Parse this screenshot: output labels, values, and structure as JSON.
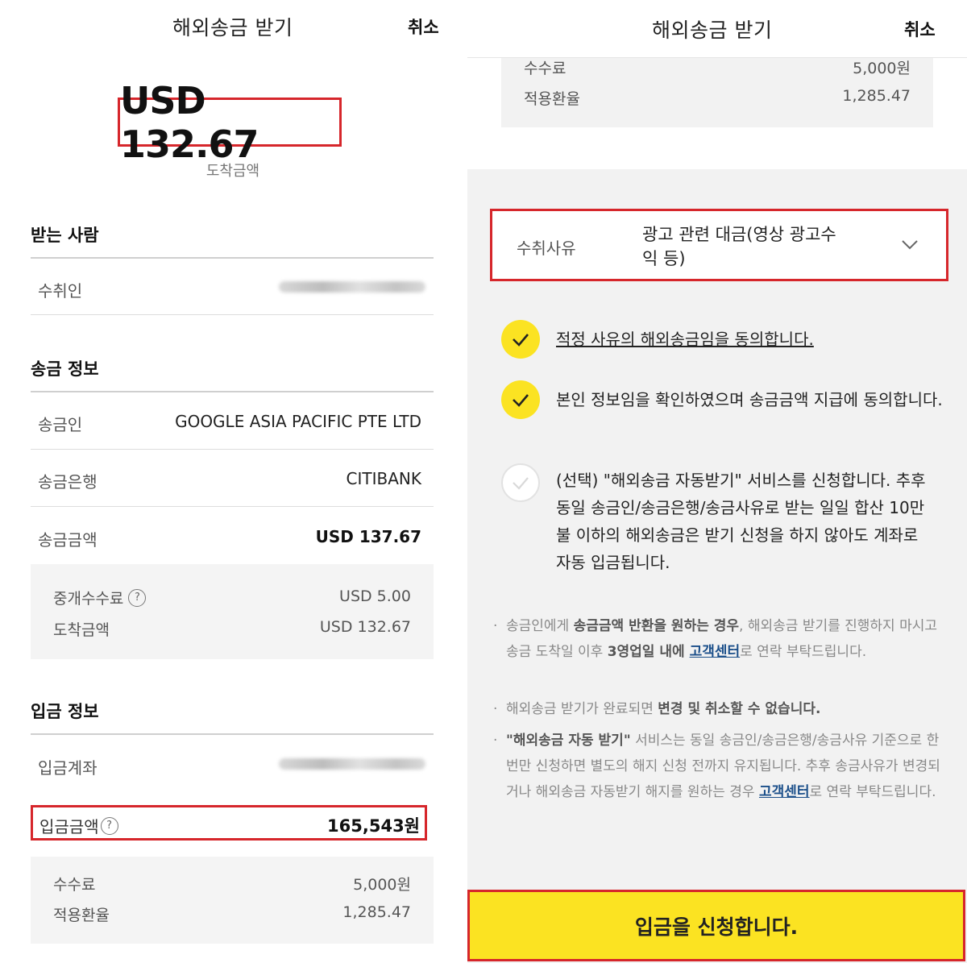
{
  "left": {
    "header": {
      "title": "해외송금 받기",
      "cancel": "취소"
    },
    "amount": "USD 132.67",
    "amount_label": "도착금액",
    "receiver_section": {
      "title": "받는 사람",
      "payee_label": "수취인"
    },
    "transfer_section": {
      "title": "송금 정보",
      "sender_label": "송금인",
      "sender_value": "GOOGLE ASIA PACIFIC PTE LTD",
      "bank_label": "송금은행",
      "bank_value": "CITIBANK",
      "amount_label": "송금금액",
      "amount_value": "USD 137.67",
      "fee_label": "중개수수료",
      "fee_value": "USD 5.00",
      "arrive_label": "도착금액",
      "arrive_value": "USD 132.67"
    },
    "deposit_section": {
      "title": "입금 정보",
      "account_label": "입금계좌",
      "amount_label": "입금금액",
      "amount_value": "165,543원",
      "fee_label": "수수료",
      "fee_value": "5,000원",
      "rate_label": "적용환율",
      "rate_value": "1,285.47"
    },
    "help_glyph": "?"
  },
  "right": {
    "header": {
      "title": "해외송금 받기",
      "cancel": "취소"
    },
    "fee_label": "수수료",
    "fee_value": "5,000원",
    "rate_label": "적용환율",
    "rate_value": "1,285.47",
    "reason_label": "수취사유",
    "reason_value": "광고 관련 대금(영상 광고수익 등)",
    "agreements": [
      {
        "text": "적정 사유의 해외송금임을 동의합니다.",
        "checked": true
      },
      {
        "text": "본인 정보임을 확인하였으며 송금금액 지급에 동의합니다.",
        "checked": true
      },
      {
        "text": "(선택) \"해외송금 자동받기\" 서비스를 신청합니다. 추후 동일 송금인/송금은행/송금사유로 받는 일일 합산 10만불 이하의 해외송금은 받기 신청을 하지 않아도 계좌로 자동 입금됩니다.",
        "checked": false
      }
    ],
    "notes": {
      "n1_a": "송금인에게 ",
      "n1_b": "송금금액 반환을 원하는 경우",
      "n1_c": ", 해외송금 받기를 진행하지 마시고 송금 도착일 이후 ",
      "n1_d": "3영업일 내에 ",
      "n1_link": "고객센터",
      "n1_e": "로 연락 부탁드립니다.",
      "n2_a": "해외송금 받기가 완료되면 ",
      "n2_b": "변경 및 취소할 수 없습니다.",
      "n3_a": "\"해외송금 자동 받기\"",
      "n3_b": " 서비스는 동일 송금인/송금은행/송금사유 기준으로 한 번만 신청하면 별도의 해지 신청 전까지 유지됩니다. 추후 송금사유가 변경되거나 해외송금 자동받기 해지를 원하는 경우 ",
      "n3_link": "고객센터",
      "n3_c": "로 연락 부탁드립니다."
    },
    "cta": "입금을 신청합니다."
  },
  "colors": {
    "accent_yellow": "#fbe322",
    "highlight_red": "#d6262b",
    "link_blue": "#1b4f8a"
  },
  "icons": {
    "check": "check-icon",
    "chevron": "chevron-down-icon",
    "help": "question-circle-icon"
  }
}
